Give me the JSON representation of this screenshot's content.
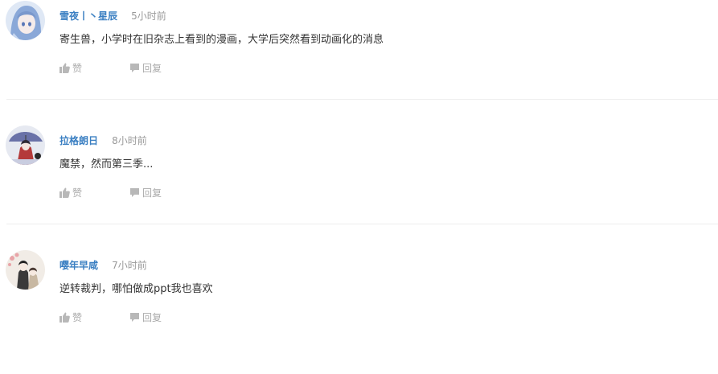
{
  "theme": {
    "username_color": "#3a7fc2",
    "time_color": "#999999",
    "icon_color": "#b8b8b8",
    "divider_color": "#eeeeee"
  },
  "comments": [
    {
      "username": "雪夜丨丶星辰",
      "time": "5小时前",
      "content": "寄生兽，小学时在旧杂志上看到的漫画，大学后突然看到动画化的消息",
      "like_label": "赞",
      "reply_label": "回复",
      "avatar": "anime-girl-blue-hair-avatar"
    },
    {
      "username": "拉格朗日",
      "time": "8小时前",
      "content": "魔禁，然而第三季...",
      "like_label": "赞",
      "reply_label": "回复",
      "avatar": "anime-girl-umbrella-avatar"
    },
    {
      "username": "嘤年早咸",
      "time": "7小时前",
      "content": "逆转裁判，哪怕做成ppt我也喜欢",
      "like_label": "赞",
      "reply_label": "回复",
      "avatar": "anime-couple-avatar"
    }
  ]
}
